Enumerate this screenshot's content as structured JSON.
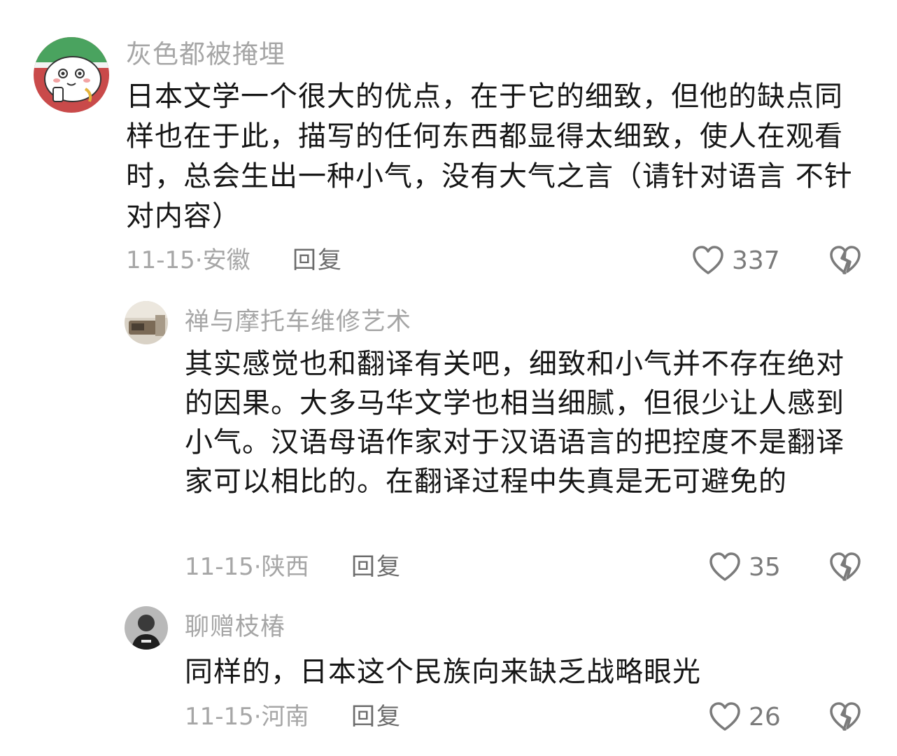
{
  "comments": [
    {
      "username": "灰色都被掩埋",
      "text": "日本文学一个很大的优点，在于它的细致，但他的缺点同样也在于此，描写的任何东西都显得太细致，使人在观看时，总会生出一种小气，没有大气之言（请针对语言 不针对内容）",
      "date_location": "11-15·安徽",
      "reply_label": "回复",
      "likes": "337",
      "avatar_icon": "cartoon-avatar-icon"
    },
    {
      "username": "禅与摩托车维修艺术",
      "text": "其实感觉也和翻译有关吧，细致和小气并不存在绝对的因果。大多马华文学也相当细腻，但很少让人感到小气。汉语母语作家对于汉语语言的把控度不是翻译家可以相比的。在翻译过程中失真是无可避免的",
      "date_location": "11-15·陕西",
      "reply_label": "回复",
      "likes": "35",
      "avatar_icon": "photo-avatar-icon"
    },
    {
      "username": "聊赠枝椿",
      "text": "同样的，日本这个民族向来缺乏战略眼光",
      "date_location": "11-15·河南",
      "reply_label": "回复",
      "likes": "26",
      "avatar_icon": "person-avatar-icon"
    }
  ],
  "icons": {
    "like": "heart-outline-icon",
    "dislike": "broken-heart-icon"
  },
  "colors": {
    "text": "#161616",
    "secondary": "#a6a6a6",
    "reply": "#6c6c6c",
    "avatar1_bg": "#c94a4a",
    "avatar1_band": "#3f9e58"
  }
}
